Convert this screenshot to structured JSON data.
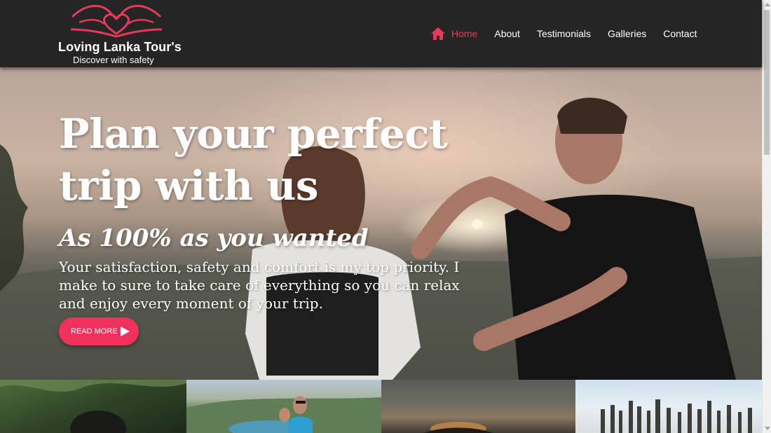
{
  "brand": {
    "title": "Loving Lanka Tour's",
    "tagline": "Discover with safety",
    "accent_color": "#e8385b"
  },
  "nav": {
    "items": [
      {
        "label": "Home",
        "icon": "home-icon",
        "active": true
      },
      {
        "label": "About"
      },
      {
        "label": "Testimonials"
      },
      {
        "label": "Galleries"
      },
      {
        "label": "Contact"
      }
    ]
  },
  "hero": {
    "headline": "Plan your perfect trip with us",
    "subheadline": "As 100% as you wanted",
    "paragraph": "Your satisfaction, safety and comfort is my top priority. I make to sure to take care of everything so you can relax and enjoy every moment of your trip.",
    "cta_label": "READ MORE",
    "cta_icon": "play-icon",
    "cta_color": "#f0315d"
  },
  "gallery": {
    "tiles": [
      "forest-photo",
      "lake-couple-photo",
      "sunset-photo",
      "ruins-pillars-photo"
    ]
  }
}
